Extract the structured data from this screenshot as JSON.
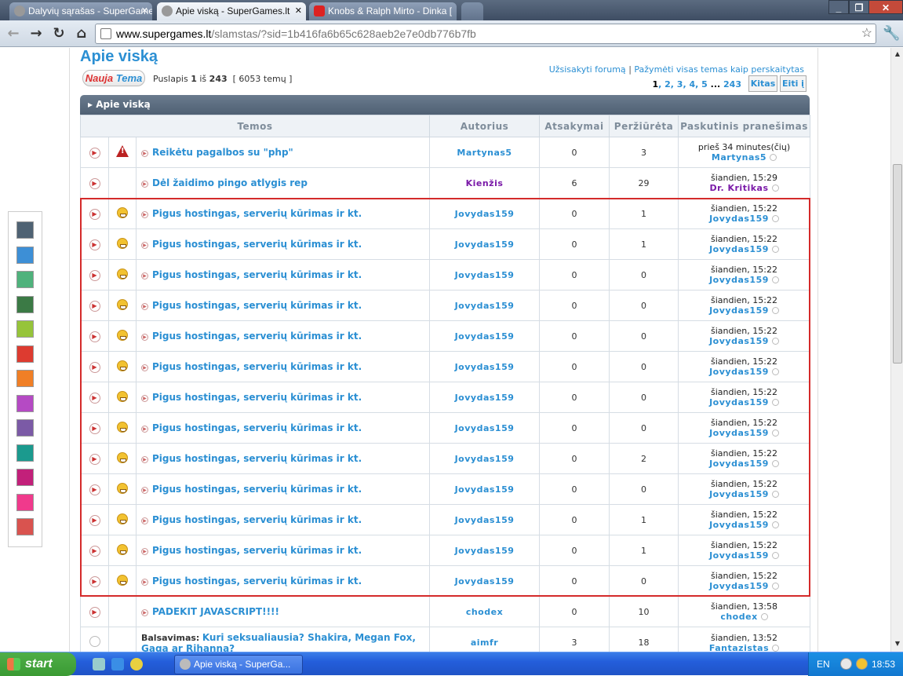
{
  "browser": {
    "tabs": [
      {
        "label": "Dalyvių sąrašas - SuperGame"
      },
      {
        "label": "Apie viską - SuperGames.lt",
        "active": true
      },
      {
        "label": "Knobs & Ralph Mirto - Dinka ["
      }
    ],
    "url_host": "www.supergames.lt",
    "url_path": "/slamstas/?sid=1b416fa6b65c628aeb2e7e0db776b7fb"
  },
  "forum": {
    "title": "Apie viską",
    "new_topic_part1": "Nauja",
    "new_topic_part2": "Tema",
    "page_label": "Puslapis",
    "page_current": "1",
    "page_of": "iš",
    "page_total": "243",
    "topic_count": "[ 6053 temų ]",
    "unsubscribe_link": "Užsisakyti forumą",
    "mark_read_link": "Pažymėti visas temas kaip perskaitytas",
    "pages": [
      "1",
      "2",
      "3",
      "4",
      "5",
      "...",
      "243"
    ],
    "next_button": "Kitas",
    "go_button": "Eiti į",
    "section_header": "Apie viską",
    "columns": [
      "Temos",
      "Autorius",
      "Atsakymai",
      "Peržiūrėta",
      "Paskutinis pranešimas"
    ],
    "rows": [
      {
        "icon": "warning",
        "title": "Reikėtu pagalbos su \"php\"",
        "author": "Martynas5",
        "replies": "0",
        "views": "3",
        "last_time": "prieš 34 minutes(čių)",
        "last_user": "Martynas5"
      },
      {
        "icon": "none",
        "title": "Dėl žaidimo pingo atlygis rep",
        "author": "Kienžis",
        "author_mod": true,
        "replies": "6",
        "views": "29",
        "last_time": "šiandien, 15:29",
        "last_user": "Dr. Kritikas",
        "last_mod": true
      },
      {
        "icon": "smiley",
        "title": "Pigus hostingas, serverių kūrimas ir kt.",
        "author": "Jovydas159",
        "replies": "0",
        "views": "1",
        "last_time": "šiandien, 15:22",
        "last_user": "Jovydas159"
      },
      {
        "icon": "smiley",
        "title": "Pigus hostingas, serverių kūrimas ir kt.",
        "author": "Jovydas159",
        "replies": "0",
        "views": "1",
        "last_time": "šiandien, 15:22",
        "last_user": "Jovydas159"
      },
      {
        "icon": "smiley",
        "title": "Pigus hostingas, serverių kūrimas ir kt.",
        "author": "Jovydas159",
        "replies": "0",
        "views": "0",
        "last_time": "šiandien, 15:22",
        "last_user": "Jovydas159"
      },
      {
        "icon": "smiley",
        "title": "Pigus hostingas, serverių kūrimas ir kt.",
        "author": "Jovydas159",
        "replies": "0",
        "views": "0",
        "last_time": "šiandien, 15:22",
        "last_user": "Jovydas159"
      },
      {
        "icon": "smiley",
        "title": "Pigus hostingas, serverių kūrimas ir kt.",
        "author": "Jovydas159",
        "replies": "0",
        "views": "0",
        "last_time": "šiandien, 15:22",
        "last_user": "Jovydas159"
      },
      {
        "icon": "smiley",
        "title": "Pigus hostingas, serverių kūrimas ir kt.",
        "author": "Jovydas159",
        "replies": "0",
        "views": "0",
        "last_time": "šiandien, 15:22",
        "last_user": "Jovydas159"
      },
      {
        "icon": "smiley",
        "title": "Pigus hostingas, serverių kūrimas ir kt.",
        "author": "Jovydas159",
        "replies": "0",
        "views": "0",
        "last_time": "šiandien, 15:22",
        "last_user": "Jovydas159"
      },
      {
        "icon": "smiley",
        "title": "Pigus hostingas, serverių kūrimas ir kt.",
        "author": "Jovydas159",
        "replies": "0",
        "views": "0",
        "last_time": "šiandien, 15:22",
        "last_user": "Jovydas159"
      },
      {
        "icon": "smiley",
        "title": "Pigus hostingas, serverių kūrimas ir kt.",
        "author": "Jovydas159",
        "replies": "0",
        "views": "2",
        "last_time": "šiandien, 15:22",
        "last_user": "Jovydas159"
      },
      {
        "icon": "smiley",
        "title": "Pigus hostingas, serverių kūrimas ir kt.",
        "author": "Jovydas159",
        "replies": "0",
        "views": "0",
        "last_time": "šiandien, 15:22",
        "last_user": "Jovydas159"
      },
      {
        "icon": "smiley",
        "title": "Pigus hostingas, serverių kūrimas ir kt.",
        "author": "Jovydas159",
        "replies": "0",
        "views": "1",
        "last_time": "šiandien, 15:22",
        "last_user": "Jovydas159"
      },
      {
        "icon": "smiley",
        "title": "Pigus hostingas, serverių kūrimas ir kt.",
        "author": "Jovydas159",
        "replies": "0",
        "views": "1",
        "last_time": "šiandien, 15:22",
        "last_user": "Jovydas159"
      },
      {
        "icon": "smiley",
        "title": "Pigus hostingas, serverių kūrimas ir kt.",
        "author": "Jovydas159",
        "replies": "0",
        "views": "0",
        "last_time": "šiandien, 15:22",
        "last_user": "Jovydas159"
      },
      {
        "icon": "none",
        "title": "PADEKIT JAVASCRIPT!!!!",
        "author": "chodex",
        "replies": "0",
        "views": "10",
        "last_time": "šiandien, 13:58",
        "last_user": "chodex"
      },
      {
        "icon": "none",
        "poll": true,
        "poll_prefix": "Balsavimas:",
        "title": "Kuri seksualiausia? Shakira, Megan Fox, Gaga ar Rihanna?",
        "author": "aimfr",
        "replies": "3",
        "views": "18",
        "last_time": "šiandien, 13:52",
        "last_user": "Fantazistas"
      }
    ]
  },
  "palette": [
    "#4f6273",
    "#3d8fd6",
    "#4fb27c",
    "#3b7a45",
    "#96c43a",
    "#dd3b30",
    "#f07f26",
    "#b54ac4",
    "#7b5aa6",
    "#1b9a8e",
    "#c2207a",
    "#f03a8c",
    "#d9534f"
  ],
  "taskbar": {
    "start_label": "start",
    "task_label": "Apie viską - SuperGa...",
    "lang": "EN",
    "clock": "18:53"
  }
}
